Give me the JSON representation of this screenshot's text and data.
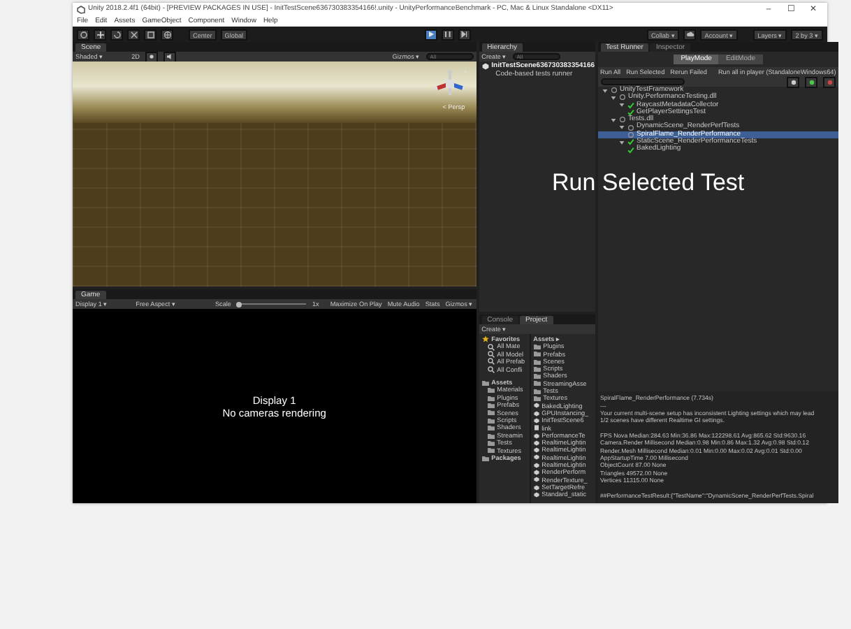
{
  "window": {
    "title": "Unity 2018.2.4f1 (64bit) - [PREVIEW PACKAGES IN USE] - InitTestScene636730383354166!.unity - UnityPerformanceBenchmark - PC, Mac & Linux Standalone <DX11>",
    "controls": [
      "–",
      "☐",
      "✕"
    ]
  },
  "menu": [
    "File",
    "Edit",
    "Assets",
    "GameObject",
    "Component",
    "Window",
    "Help"
  ],
  "toolbar": {
    "pivot": "Center",
    "space": "Global",
    "play": {
      "playing": true
    },
    "collab": "Collab ▾",
    "account": "Account ▾",
    "layers": "Layers ▾",
    "layout": "2 by 3 ▾"
  },
  "scene": {
    "tab": "Scene",
    "shading": "Shaded ▾",
    "mode_2d": "2D",
    "gizmos": "Gizmos ▾",
    "search_placeholder": "All",
    "persp": "< Persp"
  },
  "game": {
    "tab": "Game",
    "display": "Display 1 ▾",
    "aspect": "Free Aspect ▾",
    "scale_label": "Scale",
    "scale": {
      "level": 0
    },
    "scale_value": "1x",
    "toggles": [
      "Maximize On Play",
      "Mute Audio",
      "Stats",
      "Gizmos ▾"
    ],
    "message": [
      "Display 1",
      "No cameras rendering"
    ]
  },
  "hierarchy": {
    "tab": "Hierarchy",
    "create": "Create ▾",
    "search_placeholder": "All",
    "scene": "InitTestScene636730383354166",
    "item": "Code-based tests runner"
  },
  "test_runner": {
    "tabs": [
      {
        "label": "Test Runner",
        "selected": true
      },
      {
        "label": "Inspector",
        "selected": false
      }
    ],
    "modes": [
      {
        "label": "PlayMode",
        "selected": true
      },
      {
        "label": "EditMode",
        "selected": false
      }
    ],
    "buttons": [
      "Run All",
      "Run Selected",
      "Rerun Failed"
    ],
    "run_in_player": "Run all in player (StandaloneWindows64)",
    "tree": [
      {
        "label": "UnityTestFramework",
        "passed": false,
        "expanded": true,
        "selected": false,
        "children": [
          {
            "label": "Unity.PerformanceTesting.dll",
            "passed": false,
            "expanded": true,
            "selected": false,
            "children": [
              {
                "label": "RaycastMetadataCollector",
                "passed": true,
                "expanded": true,
                "selected": false,
                "children": [
                  {
                    "label": "GetPlayerSettingsTest",
                    "passed": true,
                    "selected": false
                  }
                ]
              }
            ]
          },
          {
            "label": "Tests.dll",
            "passed": false,
            "expanded": true,
            "selected": false,
            "children": [
              {
                "label": "DynamicScene_RenderPerfTests",
                "passed": false,
                "expanded": true,
                "selected": false,
                "children": [
                  {
                    "label": "SpiralFlame_RenderPerformance",
                    "passed": false,
                    "selected": true
                  }
                ]
              },
              {
                "label": "StaticScene_RenderPerformanceTests",
                "passed": true,
                "expanded": true,
                "selected": false,
                "children": [
                  {
                    "label": "BakedLighting",
                    "passed": true,
                    "selected": false
                  }
                ]
              }
            ]
          }
        ]
      }
    ],
    "log": [
      [
        "SpiralFlame_RenderPerformance (7.734s)",
        "---",
        "Your current multi-scene setup has inconsistent Lighting settings which may lead",
        "1/2 scenes have different Realtime GI settings."
      ],
      [
        "FPS Nova Median:284.63 Min:36.86 Max:122298.61 Avg:865.62 Std:9630.16",
        "Camera.Render Millisecond Median:0.98 Min:0.86 Max:1.32 Avg:0.98 Std:0.12",
        "Render.Mesh Millisecond Median:0.01 Min:0.00 Max:0.02 Avg:0.01 Std:0.00",
        "AppStartupTime 7.00 Millisecond",
        "ObjectCount 87.00 None",
        "Triangles 49572.00 None",
        "Vertices 11315.00 None"
      ],
      [
        "##PerformanceTestResult:{\"TestName\":\"DynamicScene_RenderPerfTests.Spiral"
      ]
    ]
  },
  "project": {
    "tabs": [
      {
        "label": "Console",
        "selected": false
      },
      {
        "label": "Project",
        "selected": true
      }
    ],
    "create": "Create ▾",
    "favorites": {
      "label": "Favorites",
      "items": [
        "All Mate",
        "All Model",
        "All Prefab",
        "All Confli"
      ]
    },
    "assets": {
      "label": "Assets",
      "children": [
        "Materials",
        "Plugins",
        "Prefabs",
        "Scenes",
        "Scripts",
        "Shaders",
        "Streamin",
        "Tests",
        "Textures"
      ]
    },
    "packages": "Packages",
    "breadcrumb": "Assets ▸",
    "files": [
      {
        "name": "Plugins",
        "kind": "folder"
      },
      {
        "name": "Prefabs",
        "kind": "folder"
      },
      {
        "name": "Scenes",
        "kind": "folder"
      },
      {
        "name": "Scripts",
        "kind": "folder"
      },
      {
        "name": "Shaders",
        "kind": "folder"
      },
      {
        "name": "StreamingAsse",
        "kind": "folder"
      },
      {
        "name": "Tests",
        "kind": "folder"
      },
      {
        "name": "Textures",
        "kind": "folder"
      },
      {
        "name": "BakedLighting",
        "kind": "scene"
      },
      {
        "name": "GPUInstancing_",
        "kind": "scene"
      },
      {
        "name": "InitTestScene6",
        "kind": "scene"
      },
      {
        "name": "link",
        "kind": "file"
      },
      {
        "name": "PerformanceTe",
        "kind": "scene"
      },
      {
        "name": "RealtimeLightin",
        "kind": "scene"
      },
      {
        "name": "RealtimeLightin",
        "kind": "scene"
      },
      {
        "name": "RealtimeLightin",
        "kind": "scene"
      },
      {
        "name": "RealtimeLightin",
        "kind": "scene"
      },
      {
        "name": "RenderPerform",
        "kind": "scene"
      },
      {
        "name": "RenderTexture_",
        "kind": "scene"
      },
      {
        "name": "SetTargetRefre",
        "kind": "scene"
      },
      {
        "name": "Standard_static",
        "kind": "scene"
      }
    ]
  },
  "caption": "Run Selected Test"
}
